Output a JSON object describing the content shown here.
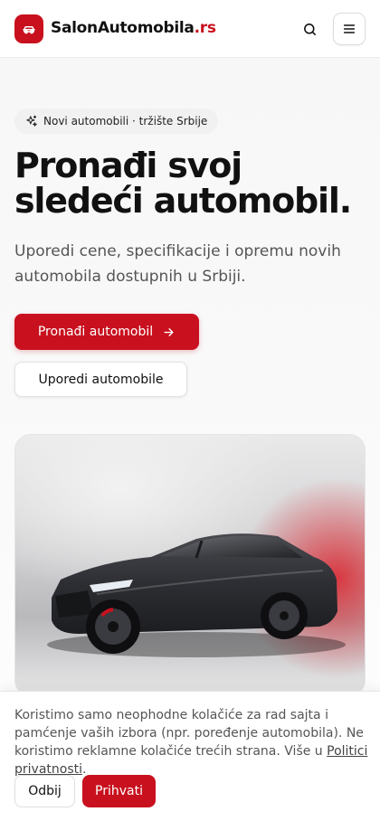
{
  "header": {
    "brand_main": "SalonAutomobila",
    "brand_tld": ".rs",
    "logo_icon": "car-icon",
    "search_icon": "search-icon",
    "menu_icon": "menu-icon"
  },
  "hero": {
    "pill_icon": "sparkles-icon",
    "pill_text": "Novi automobili · tržište Srbije",
    "title": "Pronađi svoj sledeći automobil.",
    "lead": "Uporedi cene, specifikacije i opremu novih automobila dostupnih u Srbiji.",
    "cta_primary": "Pronađi automobil",
    "cta_primary_icon": "arrow-right-icon",
    "cta_secondary": "Uporedi automobile",
    "image_alt": "dark-gray-sedan"
  },
  "cookie": {
    "text": "Koristimo samo neophodne kolačiće za rad sajta i pamćenje vaših izbora (npr. poređenje automobila). Ne koristimo reklamne kolačiće trećih strana. Više u ",
    "link": "Politici privatnosti",
    "text_end": ".",
    "reject": "Odbij",
    "accept": "Prihvati"
  },
  "colors": {
    "brand_red": "#c8101e",
    "text_dark": "#111111",
    "text_muted": "#555555"
  }
}
